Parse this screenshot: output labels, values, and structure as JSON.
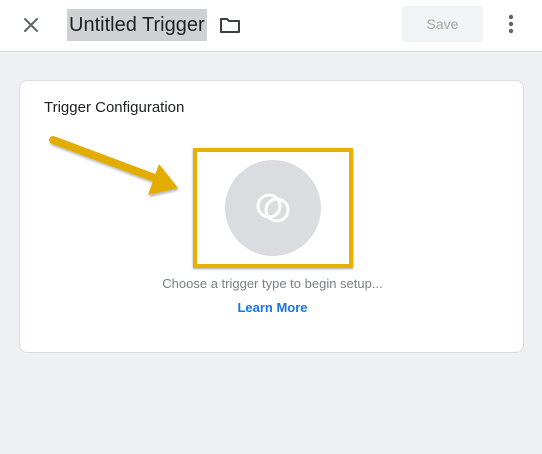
{
  "header": {
    "title": "Untitled Trigger",
    "save_label": "Save",
    "close_icon": "close-icon",
    "folder_icon": "folder-icon",
    "more_icon": "more-vert-icon"
  },
  "config_card": {
    "title": "Trigger Configuration",
    "trigger_icon": "trigger-type-icon",
    "hint": "Choose a trigger type to begin setup...",
    "learn_more": "Learn More"
  },
  "colors": {
    "accent_link": "#1a73e8",
    "highlight_box": "#e8b100",
    "annotation_arrow": "#e3ac00",
    "title_selection": "#cfd1d4"
  }
}
